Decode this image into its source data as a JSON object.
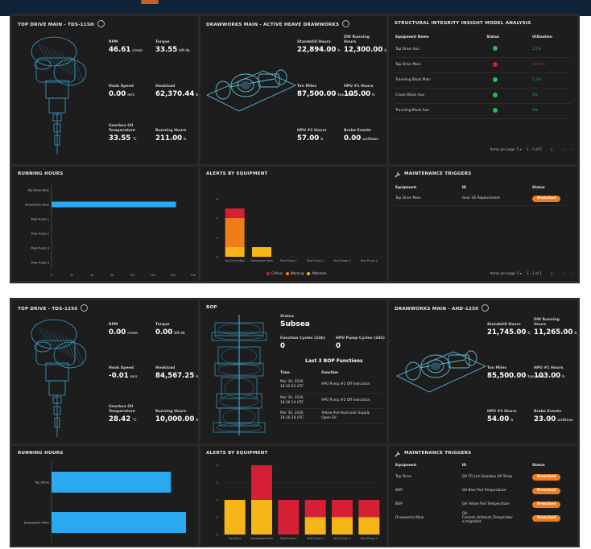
{
  "colors": {
    "critical": "#d51f35",
    "warning": "#f07d1a",
    "attention": "#f7b617",
    "bar": "#2aa8f0",
    "ok": "#1fbf4d",
    "bad": "#d51f35",
    "panel": "#1d1d1d",
    "model": "#3aa0c8"
  },
  "s1": {
    "td": {
      "title": "TOP DRIVE MAIN - TDS-11SH",
      "m": [
        {
          "l": "RPM",
          "v": "46.61",
          "u": "r/min"
        },
        {
          "l": "Torque",
          "v": "33.55",
          "u": "kft-lb"
        },
        {
          "l": "Hook Speed",
          "v": "0.00",
          "u": "m/s"
        },
        {
          "l": "Hookload",
          "v": "62,370.44",
          "u": "kg"
        },
        {
          "l": "Gearbox Oil\nTemperature",
          "v": "33.55",
          "u": "°C"
        },
        {
          "l": "Running Hours",
          "v": "211.00",
          "u": "h"
        }
      ]
    },
    "dw": {
      "title": "DRAWWORKS MAIN - ACTIVE HEAVE DRAWWORKS",
      "m": [
        {
          "l": "Standstill Hours",
          "v": "22,894.00",
          "u": "h"
        },
        {
          "l": "DW Running\nHours",
          "v": "12,300.00",
          "u": "h"
        },
        {
          "l": "Ton Miles",
          "v": "87,500.00",
          "u": "ton.mile"
        },
        {
          "l": "HPU #1 Hours",
          "v": "105.00",
          "u": "h"
        },
        {
          "l": "HPU #2 Hours",
          "v": "57.00",
          "u": "h"
        },
        {
          "l": "Brake Events",
          "v": "0.00",
          "u": "unitless"
        }
      ]
    },
    "sim": {
      "title": "STRUCTURAL INTEGRITY INSIGHT MODEL ANALYSIS",
      "cols": [
        "Equipment Name",
        "Status",
        "Utilization"
      ],
      "rows": [
        {
          "name": "Top Drive Aux",
          "status": "ok",
          "util": "1.2%"
        },
        {
          "name": "Top Drive Main",
          "status": "bad",
          "util": "105.4%"
        },
        {
          "name": "Traveling Block Main",
          "status": "ok",
          "util": "1.2%"
        },
        {
          "name": "Crown Block Aux",
          "status": "ok",
          "util": "0%"
        },
        {
          "name": "Traveling Block Aux",
          "status": "ok",
          "util": "0%"
        }
      ],
      "pager": {
        "ipp": "Items per page:",
        "n": "5",
        "range": "1 – 5 of 5"
      }
    },
    "rh": {
      "title": "RUNNING HOURS",
      "cats": [
        "Top Drive Main",
        "Drawworks Main",
        "Mud Pump 1",
        "Mud Pump 2",
        "Mud Pump 3",
        "Mud Pump 4"
      ],
      "values": [
        0,
        12300,
        0,
        0,
        0,
        0
      ],
      "ticks": [
        "0",
        "2k",
        "4k",
        "6k",
        "8k",
        "10k",
        "12k",
        "14k"
      ],
      "max": 14000
    },
    "ae": {
      "title": "ALERTS BY EQUIPMENT",
      "cats": [
        "Top Drive Main",
        "Drawworks Main",
        "Mud Pump 1",
        "Mud Pump 2",
        "Mud Pump 3",
        "Mud Pump 4"
      ],
      "stacks": [
        {
          "c": 1,
          "w": 3,
          "a": 1
        },
        {
          "c": 0,
          "w": 0,
          "a": 1
        },
        {
          "c": 0,
          "w": 0,
          "a": 0
        },
        {
          "c": 0,
          "w": 0,
          "a": 0
        },
        {
          "c": 0,
          "w": 0,
          "a": 0
        },
        {
          "c": 0,
          "w": 0,
          "a": 0
        }
      ],
      "ymax": 6,
      "yticks": [
        "0",
        "2",
        "4",
        "6"
      ],
      "legend": [
        "Critical",
        "Warning",
        "Attention"
      ]
    },
    "mt": {
      "title": "MAINTENANCE TRIGGERS",
      "cols": [
        "Equipment",
        "ID",
        "Status"
      ],
      "rows": [
        {
          "eq": "Top Drive Main",
          "id": "Gear Oil Replacement",
          "st": "Breached"
        }
      ],
      "pager": {
        "ipp": "Items per page:",
        "n": "5",
        "range": "1 – 1 of 1"
      }
    }
  },
  "s2": {
    "td": {
      "title": "TOP DRIVE - TDS-1250",
      "m": [
        {
          "l": "RPM",
          "v": "0.00",
          "u": "r/min"
        },
        {
          "l": "Torque",
          "v": "0.00",
          "u": "kft-lb"
        },
        {
          "l": "Hook Speed",
          "v": "-0.01",
          "u": "m/s"
        },
        {
          "l": "Hookload",
          "v": "84,567.25",
          "u": "kg"
        },
        {
          "l": "Gearbox Oil\nTemperature",
          "v": "28.42",
          "u": "°C"
        },
        {
          "l": "Running Hours",
          "v": "10,000.00",
          "u": "h"
        }
      ]
    },
    "bop": {
      "title": "BOP",
      "status_label": "Status",
      "status": "Subsea",
      "fc1_label": "Function Cycles (24h)",
      "fc1": "0",
      "fc2_label": "HPU Pump Cycles (24h)",
      "fc2": "0",
      "last_title": "Last 3 BOP Functions",
      "cols": [
        "Time",
        "Function"
      ],
      "rows": [
        {
          "t": "Mar 30, 2026\n18:35:03 UTC",
          "f": "HPU Pump #1 Off Indication"
        },
        {
          "t": "Mar 30, 2026\n18:36:14 UTC",
          "f": "HPU Pump #2 Off Indication"
        },
        {
          "t": "Mar 30, 2026\n18:36:18 UTC",
          "f": "Yellow Pod Hydraulic Supply\nOpen SV"
        }
      ]
    },
    "dw": {
      "title": "DRAWWORKS MAIN - AHD-1250",
      "m": [
        {
          "l": "Standstill Hours",
          "v": "21,745.00",
          "u": "h"
        },
        {
          "l": "DW Running\nHours",
          "v": "11,265.00",
          "u": "h"
        },
        {
          "l": "Ton Miles",
          "v": "85,500.00",
          "u": "ton.mile"
        },
        {
          "l": "HPU #1 Hours",
          "v": "103.00",
          "u": "h"
        },
        {
          "l": "HPU #2 Hours",
          "v": "54.00",
          "u": "h"
        },
        {
          "l": "Brake Events",
          "v": "23.00",
          "u": "unitless"
        }
      ]
    },
    "rh": {
      "title": "RUNNING HOURS",
      "cats": [
        "Top Drive",
        "Drawworks Main"
      ],
      "values": [
        10000,
        11265
      ],
      "max": 11800
    },
    "ae": {
      "title": "ALERTS BY EQUIPMENT",
      "cats": [
        "Top Drive",
        "Drawworks Main",
        "Mud Pump 1",
        "Mud Pump 2",
        "Mud Pump 3",
        "Mud Pump 4"
      ],
      "stacks": [
        {
          "c": 0,
          "w": 0,
          "a": 2
        },
        {
          "c": 2,
          "w": 0,
          "a": 2
        },
        {
          "c": 2,
          "w": 0,
          "a": 0
        },
        {
          "c": 1,
          "w": 0,
          "a": 1
        },
        {
          "c": 1,
          "w": 0,
          "a": 1
        },
        {
          "c": 1,
          "w": 0,
          "a": 1
        }
      ],
      "ymax": 4,
      "yticks": [
        "0",
        "1",
        "2",
        "3",
        "4"
      ]
    },
    "mt": {
      "title": "MAINTENANCE TRIGGERS",
      "cols": [
        "Equipment",
        "ID",
        "Status"
      ],
      "rows": [
        {
          "eq": "Top Drive",
          "id": "QA TD Lim Gearbox Oil Temp",
          "st": "Breached"
        },
        {
          "eq": "BOP",
          "id": "QA Blue Pod Temperature",
          "st": "Breached"
        },
        {
          "eq": "BOP",
          "id": "QA Yellow Pod Temperature",
          "st": "Breached"
        },
        {
          "eq": "Drawworks Main",
          "id": "QA\nCurrent_Ambient_Temperatur\ne-migrated",
          "st": "Breached"
        }
      ]
    }
  }
}
